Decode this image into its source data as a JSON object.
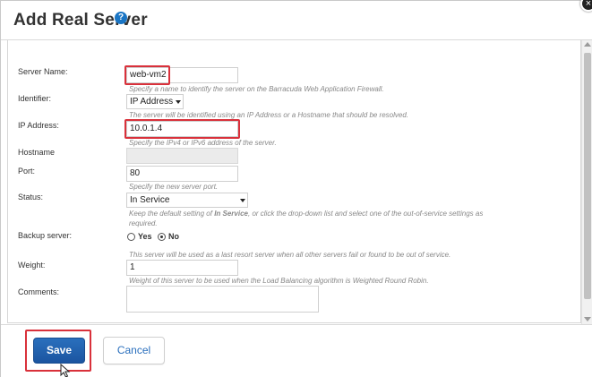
{
  "dialog": {
    "title": "Add Real Server",
    "help_icon": "?",
    "close_icon": "×"
  },
  "form": {
    "server_name": {
      "label": "Server Name:",
      "value": "web-vm2",
      "help": "Specify a name to identify the server on the Barracuda Web Application Firewall."
    },
    "identifier": {
      "label": "Identifier:",
      "value": "IP Address",
      "help": "The server will be identified using an IP Address or a Hostname that should be resolved."
    },
    "ip_address": {
      "label": "IP Address:",
      "value": "10.0.1.4",
      "help": "Specify the IPv4 or IPv6 address of the server."
    },
    "hostname": {
      "label": "Hostname",
      "value": ""
    },
    "port": {
      "label": "Port:",
      "value": "80",
      "help": "Specify the new server port."
    },
    "status": {
      "label": "Status:",
      "value": "In Service",
      "help_prefix": "Keep the default setting of ",
      "help_bold": "In Service",
      "help_suffix": ", or click the drop-down list and select one of the out-of-service settings as",
      "help_line2": "required."
    },
    "backup_server": {
      "label": "Backup server:",
      "options": [
        "Yes",
        "No"
      ],
      "selected": "No",
      "help": "This server will be used as a last resort server when all other servers fail or found to be out of service."
    },
    "weight": {
      "label": "Weight:",
      "value": "1",
      "help": "Weight of this server to be used when the Load Balancing algorithm is Weighted Round Robin."
    },
    "comments": {
      "label": "Comments:",
      "value": ""
    }
  },
  "footer": {
    "save_label": "Save",
    "cancel_label": "Cancel"
  },
  "colors": {
    "accent": "#1b55a0",
    "highlight": "#d9313b",
    "link": "#2a6fbd"
  },
  "icons": {
    "help": "help-icon",
    "close": "close-icon",
    "dropdown": "caret-down-icon",
    "cursor": "mouse-pointer-icon"
  }
}
